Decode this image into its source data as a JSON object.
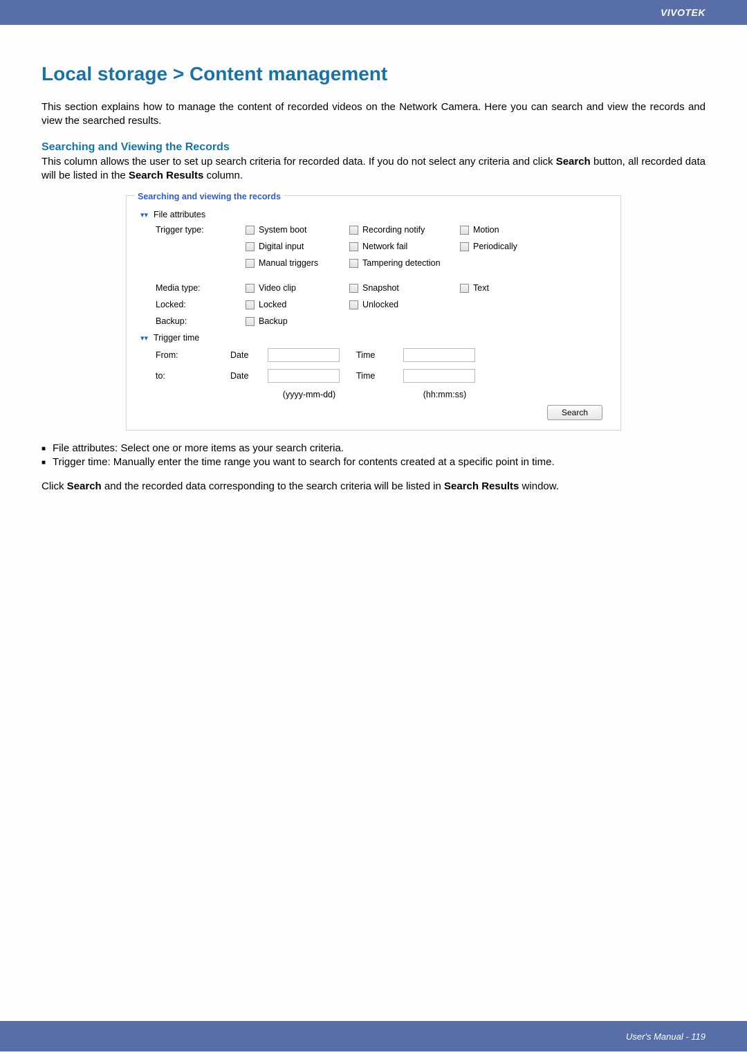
{
  "brand": "VIVOTEK",
  "pageTitle": "Local storage > Content management",
  "intro": "This section explains how to manage the content of recorded videos on the Network Camera. Here you can search and view the records and view the searched results.",
  "subheading": "Searching and Viewing the Records",
  "subpara_a": "This column allows the user to set up search criteria for recorded data. If you do not select any criteria and click ",
  "subpara_b": "Search",
  "subpara_c": " button, all recorded data will be listed in the ",
  "subpara_d": "Search Results",
  "subpara_e": " column.",
  "legend": "Searching and viewing the records",
  "section1": "File attributes",
  "labels": {
    "triggerType": "Trigger type:",
    "systemBoot": "System boot",
    "recordingNotify": "Recording notify",
    "motion": "Motion",
    "digitalInput": "Digital input",
    "networkFail": "Network fail",
    "periodically": "Periodically",
    "manualTriggers": "Manual triggers",
    "tamperingDetection": "Tampering detection",
    "mediaType": "Media type:",
    "videoClip": "Video clip",
    "snapshot": "Snapshot",
    "text": "Text",
    "locked": "Locked:",
    "lockedOpt": "Locked",
    "unlockedOpt": "Unlocked",
    "backup": "Backup:",
    "backupOpt": "Backup"
  },
  "section2": "Trigger time",
  "tt": {
    "from": "From:",
    "to": "to:",
    "date": "Date",
    "time": "Time",
    "dateFormat": "(yyyy-mm-dd)",
    "timeFormat": "(hh:mm:ss)"
  },
  "searchBtn": "Search",
  "bullet1": "File attributes: Select one or more items as your search criteria.",
  "bullet2": "Trigger time: Manually enter the time range you want to search for contents created at a specific point in time.",
  "closing_a": "Click ",
  "closing_b": "Search",
  "closing_c": " and the recorded data corresponding to the search criteria will be listed in ",
  "closing_d": "Search Results",
  "closing_e": " window.",
  "footer": "User's Manual - 119"
}
